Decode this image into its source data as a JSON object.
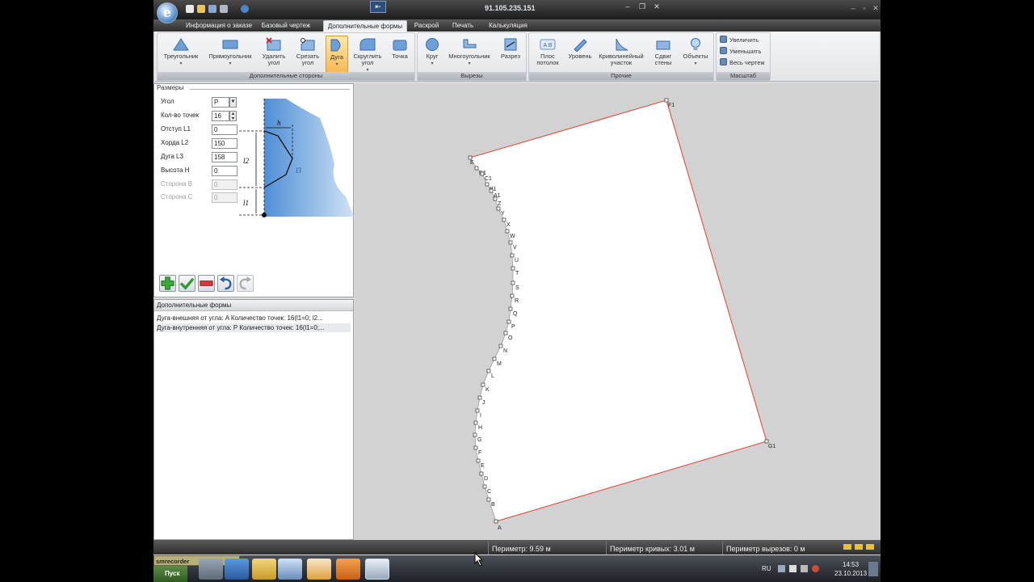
{
  "remote": {
    "title": "91.105.235.151"
  },
  "menu": {
    "tabs": [
      {
        "label": "Информация о заказе",
        "active": false
      },
      {
        "label": "Базовый чертеж",
        "active": false
      },
      {
        "label": "Дополнительные формы",
        "active": true
      },
      {
        "label": "Раскрой",
        "active": false
      },
      {
        "label": "Печать",
        "active": false
      },
      {
        "label": "Калькуляция",
        "active": false
      }
    ]
  },
  "ribbon": {
    "groups": [
      {
        "title": "Дополнительные стороны",
        "buttons": [
          {
            "label": "Треугольник",
            "icon": "triangle-icon",
            "dropdown": true
          },
          {
            "label": "Прямоугольник",
            "icon": "rectangle-icon",
            "dropdown": true
          },
          {
            "label": "Удалить угол",
            "icon": "delete-corner-icon",
            "dropdown": false
          },
          {
            "label": "Срезать угол",
            "icon": "cut-corner-icon",
            "dropdown": false
          },
          {
            "label": "Дуга",
            "icon": "arc-icon",
            "dropdown": true,
            "active": true
          },
          {
            "label": "Скруглить угол",
            "icon": "round-corner-icon",
            "dropdown": true
          },
          {
            "label": "Точка",
            "icon": "point-icon",
            "dropdown": false
          }
        ]
      },
      {
        "title": "Вырезы",
        "buttons": [
          {
            "label": "Круг",
            "icon": "circle-icon",
            "dropdown": true
          },
          {
            "label": "Многоугольник",
            "icon": "polygon-icon",
            "dropdown": true
          },
          {
            "label": "Разрез",
            "icon": "cut-icon",
            "dropdown": false
          }
        ]
      },
      {
        "title": "Прочие",
        "buttons": [
          {
            "label": "Плос потолок",
            "icon": "flat-ceiling-icon",
            "dropdown": false
          },
          {
            "label": "Уровень",
            "icon": "level-icon",
            "dropdown": false
          },
          {
            "label": "Криволинейный участок",
            "icon": "curve-section-icon",
            "dropdown": false
          },
          {
            "label": "Сдвиг стены",
            "icon": "wall-shift-icon",
            "dropdown": false
          },
          {
            "label": "Объекты",
            "icon": "bulb-icon",
            "dropdown": true
          }
        ]
      },
      {
        "title": "Масштаб",
        "buttons": [
          {
            "label": "Увеличить",
            "icon": "zoom-in-icon"
          },
          {
            "label": "Уменьшить",
            "icon": "zoom-out-icon"
          },
          {
            "label": "Весь чертеж",
            "icon": "zoom-fit-icon"
          }
        ]
      }
    ]
  },
  "params": {
    "title": "Размеры",
    "rows": [
      {
        "label": "Угол",
        "value": "P",
        "kind": "select",
        "disabled": false
      },
      {
        "label": "Кол-во точек",
        "value": "16",
        "kind": "spin",
        "disabled": false
      },
      {
        "label": "Отступ L1",
        "value": "0",
        "kind": "text",
        "disabled": false
      },
      {
        "label": "Хорда L2",
        "value": "150",
        "kind": "text",
        "disabled": false
      },
      {
        "label": "Дуга L3",
        "value": "158",
        "kind": "text",
        "disabled": false
      },
      {
        "label": "Высота H",
        "value": "0",
        "kind": "text",
        "disabled": false
      },
      {
        "label": "Сторона B",
        "value": "0",
        "kind": "text",
        "disabled": true
      },
      {
        "label": "Сторона C",
        "value": "0",
        "kind": "text",
        "disabled": true
      }
    ],
    "diagram_labels": {
      "h": "h",
      "l2": "l2",
      "l3": "l3",
      "l1": "l1"
    }
  },
  "forms": {
    "title": "Дополнительные формы",
    "items": [
      {
        "text": "Дуга-внешняя от угла: A Количество точек: 16(l1=0; l2...",
        "selected": false
      },
      {
        "text": "Дуга-внутренняя от угла: P Количество точек: 16(l1=0;...",
        "selected": true
      }
    ]
  },
  "drawing": {
    "point_labels": [
      "F1",
      "E",
      "D1",
      "C1",
      "B1",
      "A1",
      "Z",
      "Y",
      "X",
      "W",
      "V",
      "U",
      "T",
      "S",
      "R",
      "Q",
      "P",
      "O",
      "N",
      "M",
      "L",
      "K",
      "J",
      "I",
      "H",
      "G",
      "F",
      "E",
      "D",
      "C",
      "B",
      "A",
      "G1"
    ],
    "edge_color": "#e05040"
  },
  "status": {
    "perimeter": "Периметр: 9.59 м",
    "curves": "Периметр кривых: 3.01 м",
    "cutouts": "Периметр вырезов: 0 м"
  },
  "taskbar": {
    "recorder": "smrecorder",
    "start": "Пуск",
    "lang": "RU",
    "time": "14:53",
    "date": "23.10.2013"
  }
}
